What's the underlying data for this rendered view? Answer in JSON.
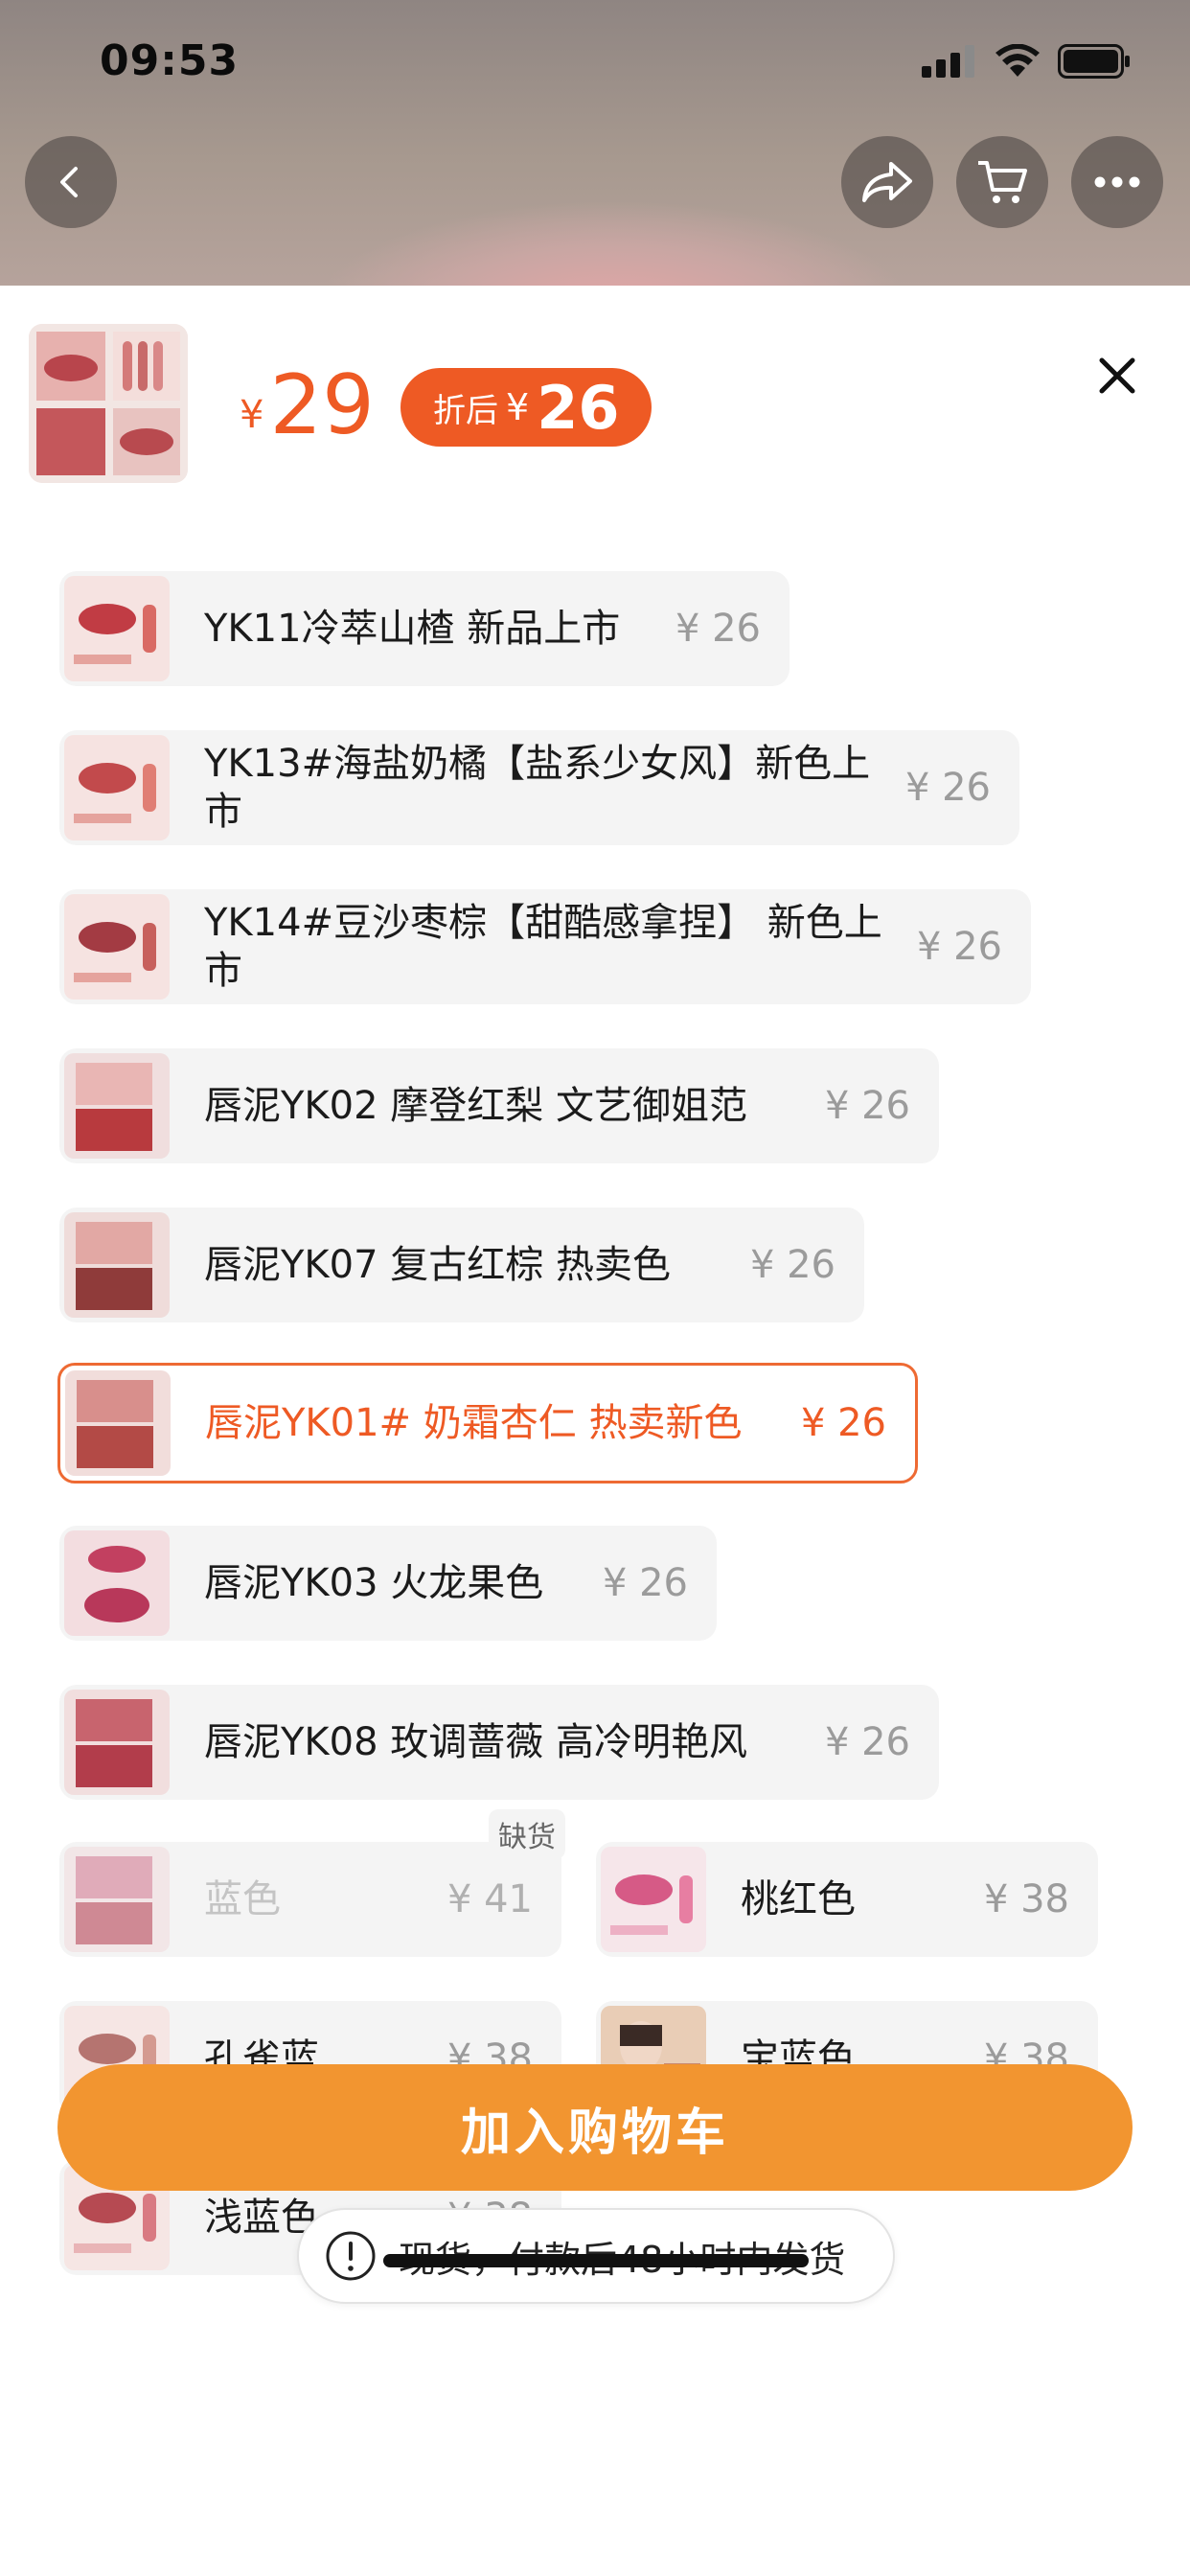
{
  "status": {
    "time": "09:53"
  },
  "header": {
    "price_symbol": "¥",
    "price": "29",
    "discount_label": "折后",
    "discount_symbol": "¥",
    "discount_price": "26"
  },
  "options": [
    {
      "name": "YK11冷萃山楂 新品上市",
      "price": "¥ 26"
    },
    {
      "name": "YK13#海盐奶橘【盐系少女风】新色上市",
      "price": "¥ 26"
    },
    {
      "name": "YK14#豆沙枣棕【甜酷感拿捏】 新色上市",
      "price": "¥ 26"
    },
    {
      "name": "唇泥YK02 摩登红梨 文艺御姐范",
      "price": "¥ 26"
    },
    {
      "name": "唇泥YK07 复古红棕 热卖色",
      "price": "¥ 26"
    },
    {
      "name": "唇泥YK01# 奶霜杏仁 热卖新色",
      "price": "¥ 26",
      "selected": true
    },
    {
      "name": "唇泥YK03 火龙果色",
      "price": "¥ 26"
    },
    {
      "name": "唇泥YK08 玫调蔷薇 高冷明艳风",
      "price": "¥ 26"
    },
    {
      "name": "蓝色",
      "price": "¥ 41",
      "badge": "缺货",
      "disabled": true
    },
    {
      "name": "桃红色",
      "price": "¥ 38"
    },
    {
      "name": "孔雀蓝",
      "price": "¥ 38"
    },
    {
      "name": "宝蓝色",
      "price": "¥ 38"
    },
    {
      "name": "浅蓝色",
      "price": "¥ 38"
    }
  ],
  "toast": {
    "text": "现货，付款后48小时内发货"
  },
  "cart_button": {
    "label": "加入购物车"
  },
  "colors": {
    "accent": "#ee5a24",
    "button": "#f29530"
  },
  "icons": [
    "back-icon",
    "share-icon",
    "cart-icon",
    "more-icon",
    "close-icon",
    "info-icon"
  ]
}
